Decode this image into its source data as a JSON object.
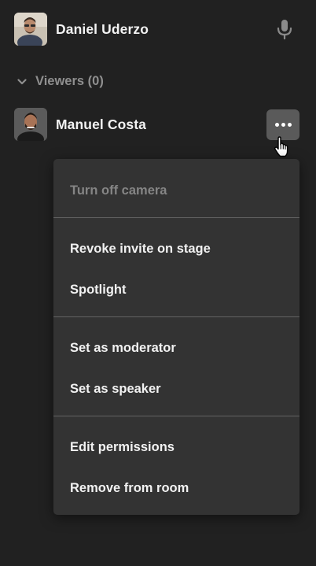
{
  "participants": {
    "speaker": {
      "name": "Daniel Uderzo",
      "mic_icon": "microphone-icon"
    },
    "viewers_section": {
      "label": "Viewers (0)",
      "chevron_icon": "chevron-down-icon"
    },
    "viewer": {
      "name": "Manuel Costa",
      "more_icon": "more-horizontal-icon"
    }
  },
  "context_menu": {
    "groups": [
      [
        {
          "label": "Turn off camera",
          "disabled": true
        }
      ],
      [
        {
          "label": "Revoke invite on stage",
          "disabled": false
        },
        {
          "label": "Spotlight",
          "disabled": false
        }
      ],
      [
        {
          "label": "Set as moderator",
          "disabled": false
        },
        {
          "label": "Set as speaker",
          "disabled": false
        }
      ],
      [
        {
          "label": "Edit permissions",
          "disabled": false
        },
        {
          "label": "Remove from room",
          "disabled": false
        }
      ]
    ]
  },
  "colors": {
    "background": "#212121",
    "menu_background": "#333333",
    "button_background": "#5a5a5a",
    "text_primary": "#f2f2f2",
    "text_muted": "#858585"
  }
}
